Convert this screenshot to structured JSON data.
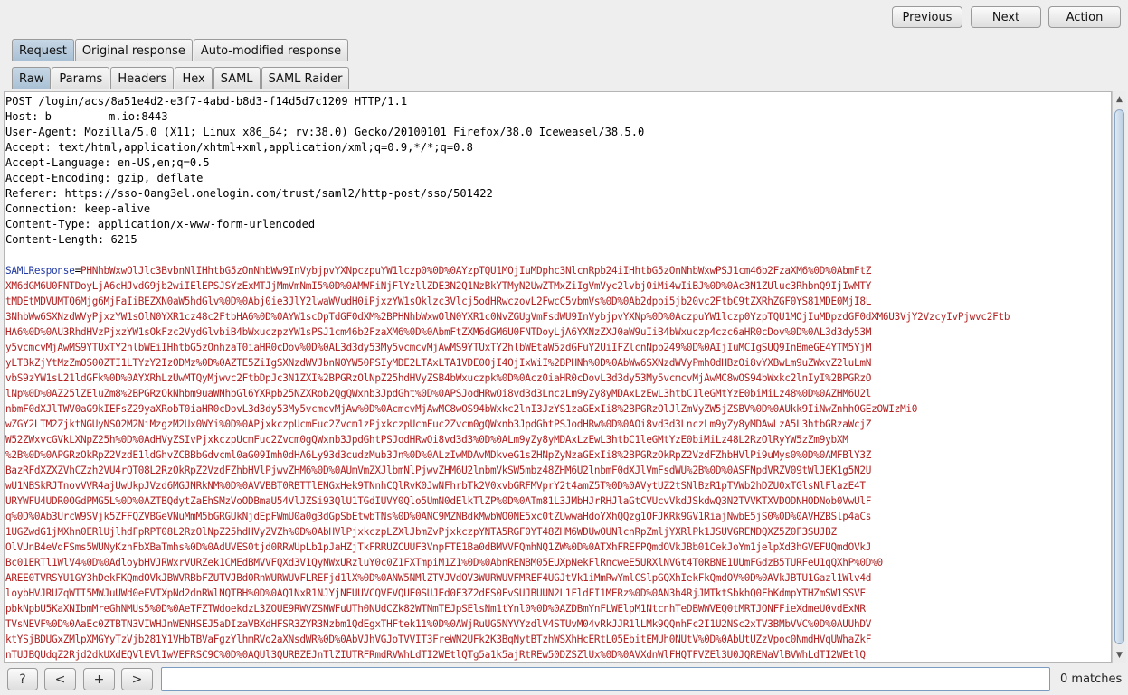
{
  "toolbar": {
    "previous_label": "Previous",
    "next_label": "Next",
    "action_label": "Action"
  },
  "tabs": [
    {
      "label": "Request",
      "active": true
    },
    {
      "label": "Original response",
      "active": false
    },
    {
      "label": "Auto-modified response",
      "active": false
    }
  ],
  "subtabs": [
    {
      "label": "Raw",
      "active": true
    },
    {
      "label": "Params",
      "active": false
    },
    {
      "label": "Headers",
      "active": false
    },
    {
      "label": "Hex",
      "active": false
    },
    {
      "label": "SAML",
      "active": false
    },
    {
      "label": "SAML Raider",
      "active": false
    }
  ],
  "request": {
    "headers": [
      "POST /login/acs/8a51e4d2-e3f7-4abd-b8d3-f14d5d7c1209 HTTP/1.1",
      "Host: b",
      "User-Agent: Mozilla/5.0 (X11; Linux x86_64; rv:38.0) Gecko/20100101 Firefox/38.0 Iceweasel/38.5.0",
      "Accept: text/html,application/xhtml+xml,application/xml;q=0.9,*/*;q=0.8",
      "Accept-Language: en-US,en;q=0.5",
      "Accept-Encoding: gzip, deflate",
      "Referer: https://sso-0ang3el.onelogin.com/trust/saml2/http-post/sso/501422",
      "Connection: keep-alive",
      "Content-Type: application/x-www-form-urlencoded",
      "Content-Length: 6215"
    ],
    "host_suffix": "m.io:8443",
    "param_name": "SAMLResponse",
    "param_eq": "=",
    "body_lines": [
      "PHNhbWxwOlJlc3BvbnNlIHhtbG5zOnNhbWw9InVybjpvYXNpczpuYW1lczp0%0D%0AYzpTQU1MOjIuMDphc3NlcnRpb24iIHhtbG5zOnNhbWxwPSJ1cm46b2FzaXM6%0D%0AbmFtZ",
      "XM6dGM6U0FNTDoyLjA6cHJvdG9jb2wiIElEPSJSYzExMTJjMmVmNmI5%0D%0AMWFiNjFlYzllZDE3N2Q1NzBkYTMyN2UwZTMxZiIgVmVyc2lvbj0iMi4wIiBJ%0D%0Ac3N1ZUluc3RhbnQ9IjIwMTY",
      "tMDEtMDVUMTQ6Mjg6MjFaIiBEZXN0aW5hdGlv%0D%0Abj0ie3JlY2lwaWVudH0iPjxzYW1sOklzc3Vlcj5odHRwczovL2FwcC5vbmVs%0D%0Ab2dpbi5jb20vc2FtbC9tZXRhZGF0YS81MDE0MjI8L",
      "3NhbWw6SXNzdWVyPjxzYW1sOlN0YXR1cz48c2FtbHA6%0D%0AYW1scDpTdGF0dXM%2BPHNhbWxwOlN0YXR1c0NvZGUgVmFsdWU9InVybjpvYXNp%0D%0AczpuYW1lczp0YzpTQU1MOjIuMDpzdGF0dXM6U3VjY2VzcyIvPjwvc2Ftb",
      "HA6%0D%0AU3RhdHVzPjxzYW1sOkFzc2VydGlvbiB4bWxuczpzYW1sPSJ1cm46b2FzaXM6%0D%0AbmFtZXM6dGM6U0FNTDoyLjA6YXNzZXJ0aW9uIiB4bWxuczp4czc6aHR0cDov%0D%0AL3d3dy53M",
      "y5vcmcvMjAwMS9YTUxTY2hlbWEiIHhtbG5zOnhzaT0iaHR0cDov%0D%0AL3d3dy53My5vcmcvMjAwMS9YTUxTY2hlbWEtaW5zdGFuY2UiIFZlcnNpb249%0D%0AIjIuMCIgSUQ9InBmeGE4YTM5YjM",
      "yLTBkZjYtMzZmOS00ZTI1LTYzY2IzODMz%0D%0AZTE5ZiIgSXNzdWVJbnN0YW50PSIyMDE2LTAxLTA1VDE0OjI4OjIxWiI%2BPHNh%0D%0AbWw6SXNzdWVyPmh0dHBzOi8vYXBwLm9uZWxvZ2luLmN",
      "vbS9zYW1sL21ldGFk%0D%0AYXRhLzUwMTQyMjwvc2FtbDpJc3N1ZXI%2BPGRzOlNpZ25hdHVyZSB4bWxuczpk%0D%0Acz0iaHR0cDovL3d3dy53My5vcmcvMjAwMC8wOS94bWxkc2lnIyI%2BPGRzO",
      "lNp%0D%0AZ25lZEluZm8%2BPGRzOkNhbm9uaWNhbGl6YXRpb25NZXRob2QgQWxnb3JpdGht%0D%0APSJodHRwOi8vd3d3LnczLm9yZy8yMDAxLzEwL3htbC1leGMtYzE0biMiLz48%0D%0AZHM6U2l",
      "nbmF0dXJlTWV0aG9kIEFsZ29yaXRobT0iaHR0cDovL3d3dy53My5vcmcvMjAw%0D%0AcmcvMjAwMC8wOS94bWxkc2lnI3JzYS1zaGExIi8%2BPGRzOlJlZmVyZW5jZSBV%0D%0AUkk9IiNwZnhhOGEzOWIzMi0",
      "wZGY2LTM2ZjktNGUyNS02M2NiMzgzM2Ux0WYi%0D%0APjxkczpUcmFuc2Zvcm1zPjxkczpUcmFuc2Zvcm0gQWxnb3JpdGhtPSJodHRw%0D%0AOi8vd3d3LnczLm9yZy8yMDAwLzA5L3htbGRzaWcjZ",
      "W52ZWxvcGVkLXNpZ25h%0D%0AdHVyZSIvPjxkczpUcmFuc2Zvcm0gQWxnb3JpdGhtPSJodHRwOi8vd3d3%0D%0ALm9yZy8yMDAxLzEwL3htbC1leGMtYzE0biMiLz48L2RzOlRyYW5zZm9ybXM",
      "%2B%0D%0APGRzOkRpZ2VzdE1ldGhvZCBBbGdvcml0aG09Imh0dHA6Ly93d3cudzMub3Jn%0D%0ALzIwMDAvMDkveG1sZHNpZyNzaGExIi8%2BPGRzOkRpZ2VzdFZhbHVlPi9uMys0%0D%0AMFBlY3Z",
      "BazRFdXZXZVhCZzh2VU4rQT08L2RzOkRpZ2VzdFZhbHVlPjwvZHM6%0D%0AUmVmZXJlbmNlPjwvZHM6U2lnbmVkSW5mbz48ZHM6U2lnbmF0dXJlVmFsdWU%2B%0D%0ASFNpdVRZV09tWlJEK1g5N2U",
      "wU1NBSkRJTnovVVR4ajUwUkpJVzd6MGJNRkNM%0D%0AVVBBT0RBTTlENGxHek9TNnhCQlRvK0JwNFhrbTk2V0xvbGRFMVprY2t4amZ5T%0D%0AVytUZ2tSNlBzR1pTVWb2hDZU0xTGlsNlFlazE4T",
      "URYWFU4UDR0OGdPMG5L%0D%0AZTBQdytZaEhSMzVoODBmaU54VlJZSi93QlU1TGdIUVY0Qlo5UmN0dElkTlZP%0D%0ATm81L3JMbHJrRHJlaGtCVUcvVkdJSkdwQ3N2TVVKTXVDODNHODNob0VwUlF",
      "q%0D%0Ab3UrcW9SVjk5ZFFQZVBGeVNuMmM5bGRGUkNjdEpFWmU0a0g3dGpSbEtwbTNs%0D%0ANC9MZNBdkMwbWO0NE5xc0tZUwwaHdoYXhQQzg1OFJKRk9GV1RiajNwbE5jS0%0D%0AVHZBSlp4aCs",
      "1UGZwdG1jMXhn0ERlUjlhdFpRPT08L2RzOlNpZ25hdHVyZVZh%0D%0AbHVlPjxkczpLZXlJbmZvPjxkczpYNTA5RGF0YT48ZHM6WDUwOUNlcnRpZmljYXRlPk1JSUVGRENDQXZ5Z0F3SUJBZ",
      "OlVUnB4eVdFSms5WUNyKzhFbXBaTmhs%0D%0AdUVES0tjd0RRWUpLb1pJaHZjTkFRRUZCUUF3VnpFTE1Ba0dBMVVFQmhNQ1ZW%0D%0ATXhFREFPQmdOVkJBb01CekJoYm1jelpXd3hGVEFUQmdOVkJ",
      "Bc01ERTl1WlV4%0D%0AdloybHVJRWxrVURZek1CMEdBMVVFQXd3V1QyNWxURzluY0c0Z1FXTmpiM1Z1%0D%0AbnRENBM05EUXpNekFlRncweE5URXlNVGt4T0RBNE1UUmFGdzB5TURFeU1qQXhP%0D%0",
      "AREE0TVRSYU1GY3hDekFKQmdOVkJBWVRBbFZUTVJBd0RnWURWUVFLREFjd1lX%0D%0ANW5NMlZTVJVdOV3WURWUVFMREF4UGJtVk1iMmRwYmlCSlpGQXhIekFkQmdOV%0D%0AVkJBTU1Gazl1Wlv4d",
      "loybHVJRUZqWTI5MWJuUWd0eEVTXpNd2dnRWlNQTBH%0D%0AQ1NxR1NJYjNEUUVCQVFVQUE0SUJEd0F3Z2dFS0FvSUJBUUN2L1FldFI1MERz%0D%0AN3h4RjJMTktSbkhQ0FhKdmpYTHZmSW1SSVF",
      "pbkNpbU5KaXNIbmMreGhNMUs5%0D%0AeTFZTWdoekdzL3ZOUE9RWVZSNWFuUTh0NUdCZk82WTNmTEJpSElsNm1tYnl0%0D%0AZDBmYnFLWElpM1NtcnhTeDBWWVEQ0tMRTJONFFieXdmeU0vdExNR",
      "TVsNEVF%0D%0AaEc0ZTBTN3VIWHJnWENHSEJ5aDIzaVBXdHFSR3ZYR3Nzbm1QdEgxTHFtek11%0D%0AWjRuUG5NYVYzdlV4STUvM04vRkJJR1lLMk9QQnhFc2I1U2NSc2xTV3BMbVVC%0D%0AUUhDV",
      "ktYSjBDUGxZMlpXMGYyTzVjb281Y1VHbTBVaFgzYlhmRVo2aXNsdWR%0D%0AbVJhVGJoTVVIT3FreWN2UFk2K3BqNytBTzhWSXhHcERtL05EbitEMUh0NUtV%0D%0AbUtUZzVpoc0NmdHVqUWhaZkF",
      "nTUJBQUdqZ2Rjd2dkUXdEQVlEVlIwVEFRSC9C%0D%0AQUl3QURBZEJnTlZIUTRFRmdRVWhLdTI2WEtlQTg5a1k5ajRtREw50DZSZlUx%0D%0AVXdnWlFHQTFVZEl3U0JQRENaVlBVWhLdTI2WEtlQ"
    ]
  },
  "search": {
    "value": "",
    "matches": "0 matches"
  },
  "find_buttons": {
    "help": "?",
    "prev": "<",
    "add": "+",
    "next": ">"
  }
}
